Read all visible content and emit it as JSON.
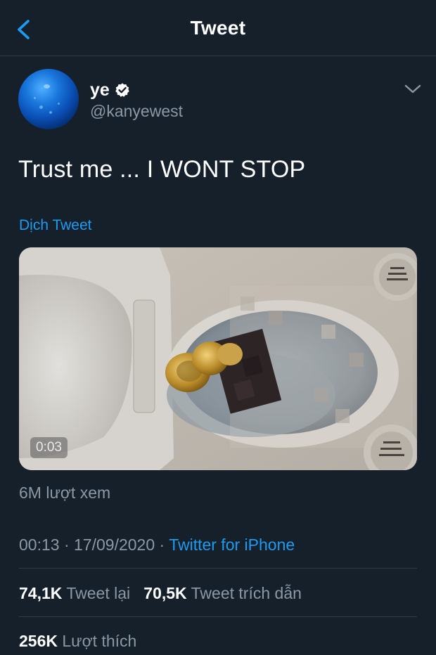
{
  "header": {
    "title": "Tweet",
    "back_icon": "chevron-left-icon"
  },
  "author": {
    "name": "ye",
    "handle": "@kanyewest",
    "verified": true
  },
  "tweet": {
    "text": "Trust me ... I WONT STOP",
    "translate_label": "Dịch Tweet"
  },
  "media": {
    "type": "video",
    "duration": "0:03"
  },
  "views": "6M lượt xem",
  "meta": {
    "time": "00:13",
    "date": "17/09/2020",
    "source": "Twitter for iPhone",
    "separator": "·"
  },
  "stats": {
    "retweets_count": "74,1K",
    "retweets_label": "Tweet lại",
    "quotes_count": "70,5K",
    "quotes_label": "Tweet trích dẫn",
    "likes_count": "256K",
    "likes_label": "Lượt thích"
  },
  "colors": {
    "background": "#15202b",
    "accent": "#1d9bf0",
    "secondary_text": "#8b98a5",
    "divider": "#2f3b48"
  }
}
